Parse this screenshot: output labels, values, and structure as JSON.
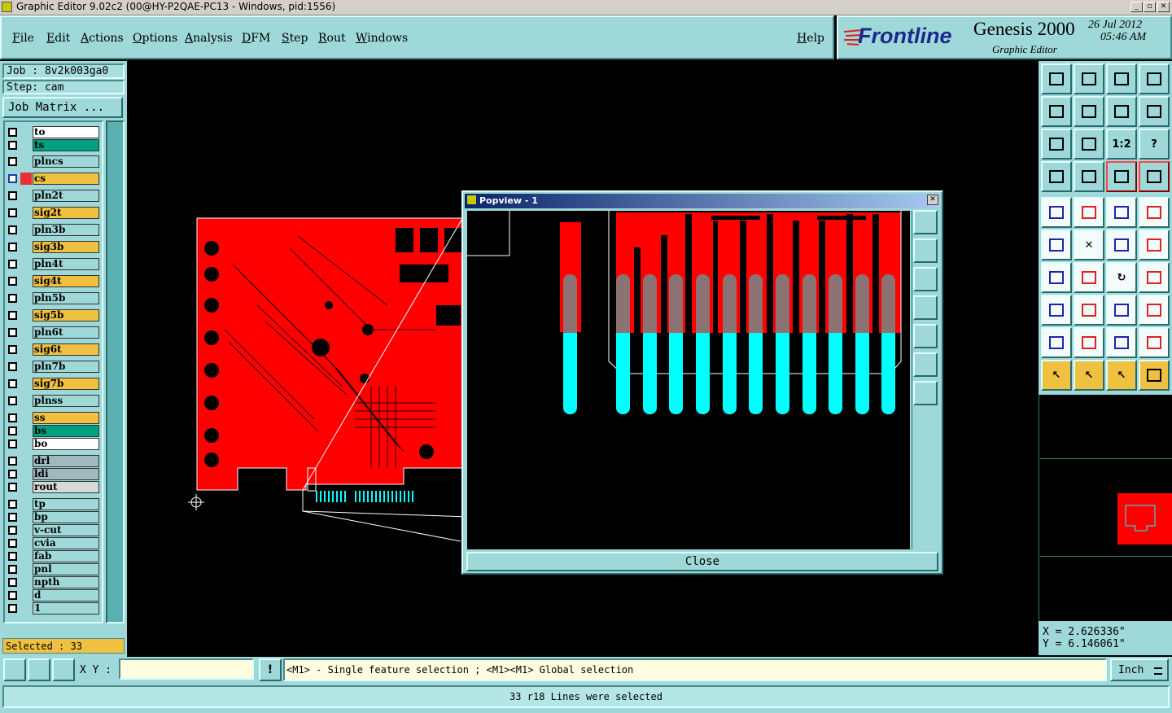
{
  "window": {
    "title": "Graphic Editor 9.02c2 (00@HY-P2QAE-PC13 - Windows, pid:1556)"
  },
  "menu": {
    "file": "File",
    "edit": "Edit",
    "actions": "Actions",
    "options": "Options",
    "analysis": "Analysis",
    "dfm": "DFM",
    "step": "Step",
    "rout": "Rout",
    "windows": "Windows",
    "help": "Help"
  },
  "brand": {
    "logo": "Frontline",
    "product": "Genesis 2000",
    "subtitle": "Graphic Editor",
    "date": "26 Jul 2012",
    "time": "05:46 AM"
  },
  "job": {
    "job_label": "Job : 8v2k003ga0",
    "step_label": "Step: cam",
    "matrix_button": "Job Matrix ..."
  },
  "layers": [
    {
      "name": "to",
      "color": "#ffffff"
    },
    {
      "name": "ts",
      "color": "#00a080"
    },
    {
      "name": "plncs",
      "color": "#9ed8d8"
    },
    {
      "name": "cs",
      "color": "#f0c040",
      "active": true
    },
    {
      "name": "pln2t",
      "color": "#9ed8d8"
    },
    {
      "name": "sig2t",
      "color": "#f0c040"
    },
    {
      "name": "pln3b",
      "color": "#9ed8d8"
    },
    {
      "name": "sig3b",
      "color": "#f0c040"
    },
    {
      "name": "pln4t",
      "color": "#9ed8d8"
    },
    {
      "name": "sig4t",
      "color": "#f0c040"
    },
    {
      "name": "pln5b",
      "color": "#9ed8d8"
    },
    {
      "name": "sig5b",
      "color": "#f0c040"
    },
    {
      "name": "pln6t",
      "color": "#9ed8d8"
    },
    {
      "name": "sig6t",
      "color": "#f0c040"
    },
    {
      "name": "pln7b",
      "color": "#9ed8d8"
    },
    {
      "name": "sig7b",
      "color": "#f0c040"
    },
    {
      "name": "plnss",
      "color": "#9ed8d8"
    },
    {
      "name": "ss",
      "color": "#f0c040"
    },
    {
      "name": "bs",
      "color": "#00a080"
    },
    {
      "name": "bo",
      "color": "#ffffff"
    },
    {
      "name": "drl",
      "color": "#a0b8c0"
    },
    {
      "name": "ldi",
      "color": "#a0b8c0"
    },
    {
      "name": "rout",
      "color": "#d8d8d8"
    },
    {
      "name": "tp",
      "color": "#9ed8d8"
    },
    {
      "name": "bp",
      "color": "#9ed8d8"
    },
    {
      "name": "v-cut",
      "color": "#9ed8d8"
    },
    {
      "name": "cvia",
      "color": "#9ed8d8"
    },
    {
      "name": "fab",
      "color": "#9ed8d8"
    },
    {
      "name": "pnl",
      "color": "#9ed8d8"
    },
    {
      "name": "npth",
      "color": "#9ed8d8"
    },
    {
      "name": "d",
      "color": "#9ed8d8"
    },
    {
      "name": "1",
      "color": "#9ed8d8"
    }
  ],
  "selected": {
    "label": "Selected : 33"
  },
  "popview": {
    "title": "Popview - 1",
    "close_label": "Close"
  },
  "coords": {
    "x": "X = 2.626336\"",
    "y": "Y = 6.146061\""
  },
  "bottom": {
    "xy_label": "X Y :",
    "xy_value": "",
    "hint": "<M1> - Single feature selection ; <M1><M1> Global selection",
    "units": "Inch",
    "status": "33 r18 Lines were selected"
  },
  "toolbar_icons": [
    "open-job-icon",
    "save-icon",
    "home-icon",
    "window-icon",
    "import-icon",
    "export-icon",
    "rotate-icon",
    "snake-icon",
    "zoom-fit-icon",
    "pan-icon",
    "scale-icon",
    "help-icon",
    "tools-icon",
    "grid-icon",
    "layers-red-icon",
    "layers-red2-icon",
    "add-pad-icon",
    "edit-shape-icon",
    "measure-icon",
    "circle-icon",
    "connect-icon",
    "delete-icon",
    "move-icon",
    "copy-icon",
    "line-icon",
    "slash-icon",
    "arc-icon",
    "split-icon",
    "pad-select-icon",
    "cut-icon",
    "dimension-icon",
    "group-icon",
    "triangle-icon",
    "triangle2-icon",
    "triangle3-icon",
    "triangle4-icon",
    "pointer-icon",
    "pointer2-icon",
    "pointer3-icon",
    "route-icon"
  ],
  "colors": {
    "panel": "#9ed8d8",
    "board": "#ff0000",
    "fingers": "#00ffff",
    "active_layer": "#f0c040"
  }
}
